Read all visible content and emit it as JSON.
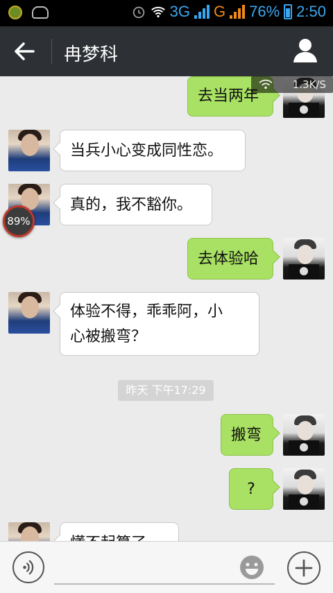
{
  "status_bar": {
    "network_3g": "3G",
    "network_g": "G",
    "battery": "76%",
    "time": "2:50"
  },
  "title_bar": {
    "contact_name": "冉梦科"
  },
  "network_speed": "1.3K/S",
  "progress_badge": "89%",
  "messages": [
    {
      "side": "right",
      "text": "去当两年"
    },
    {
      "side": "left",
      "text": "当兵小心变成同性恋。"
    },
    {
      "side": "left",
      "text": "真的，我不豁你。"
    },
    {
      "side": "right",
      "text": "去体验哈"
    },
    {
      "side": "left",
      "text": "体验不得，乖乖阿，小心被搬弯？"
    },
    {
      "side": "right",
      "text": "搬弯"
    },
    {
      "side": "right",
      "text": "?"
    },
    {
      "side": "left",
      "text": "懂不起算了"
    }
  ],
  "timestamp": "昨天 下午17:29",
  "colors": {
    "titlebar_bg": "#2d3135",
    "sent_bubble": "#a8e163",
    "received_bubble": "#ffffff",
    "status_blue": "#3aa7f0",
    "status_orange": "#f08a1a"
  }
}
